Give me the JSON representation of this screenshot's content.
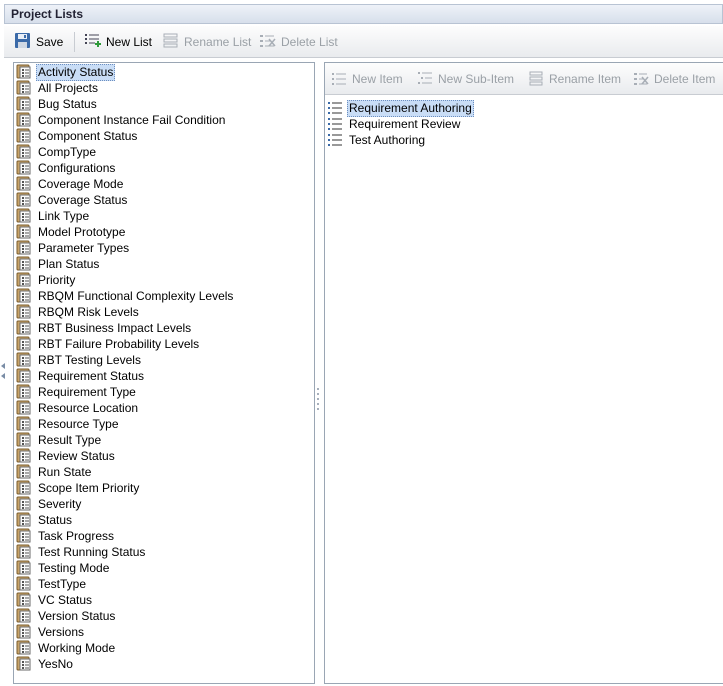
{
  "window": {
    "title": "Project Lists"
  },
  "toolbar": {
    "save_label": "Save",
    "new_list_label": "New List",
    "rename_list_label": "Rename List",
    "delete_list_label": "Delete List"
  },
  "lists": {
    "selected": "Activity Status",
    "items": [
      "Activity Status",
      "All Projects",
      "Bug Status",
      "Component Instance Fail Condition",
      "Component Status",
      "CompType",
      "Configurations",
      "Coverage Mode",
      "Coverage Status",
      "Link Type",
      "Model Prototype",
      "Parameter Types",
      "Plan Status",
      "Priority",
      "RBQM Functional Complexity Levels",
      "RBQM Risk Levels",
      "RBT Business Impact Levels",
      "RBT Failure Probability Levels",
      "RBT Testing Levels",
      "Requirement Status",
      "Requirement Type",
      "Resource Location",
      "Resource Type",
      "Result Type",
      "Review Status",
      "Run State",
      "Scope Item Priority",
      "Severity",
      "Status",
      "Task Progress",
      "Test Running Status",
      "Testing Mode",
      "TestType",
      "VC Status",
      "Version Status",
      "Versions",
      "Working Mode",
      "YesNo"
    ]
  },
  "items_toolbar": {
    "new_item_label": "New Item",
    "new_sub_item_label": "New Sub-Item",
    "rename_item_label": "Rename Item",
    "delete_item_label": "Delete Item"
  },
  "list_items": {
    "selected": "Requirement Authoring",
    "items": [
      "Requirement Authoring",
      "Requirement Review",
      "Test Authoring"
    ]
  },
  "colors": {
    "selection_bg": "#c9ddf6",
    "disabled_text": "#9aa0a6",
    "folder_icon": "#c8a46a"
  }
}
